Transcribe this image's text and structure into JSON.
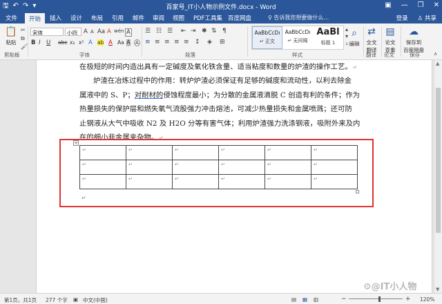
{
  "titlebar": {
    "title": "百家号_IT小人物示例文件.docx - Word",
    "qat": [
      "save-icon",
      "undo-icon",
      "redo-icon",
      "customize-icon"
    ],
    "qat_glyphs": [
      "🖫",
      "↶",
      "↷",
      "▾"
    ],
    "window_buttons": [
      "ribbon-display-icon",
      "minimize-icon",
      "restore-icon",
      "close-icon"
    ],
    "window_glyphs": [
      "▣",
      "—",
      "❐",
      "✕"
    ]
  },
  "tabs": [
    "文件",
    "开始",
    "插入",
    "设计",
    "布局",
    "引用",
    "邮件",
    "审阅",
    "视图",
    "PDF工具集",
    "百度网盘"
  ],
  "active_tab": "开始",
  "tell_me": "♀ 告诉我您想要做什么...",
  "account": {
    "login": "登录",
    "share": "♙ 共享"
  },
  "ribbon": {
    "clipboard": {
      "paste": "粘贴",
      "label": "剪贴板"
    },
    "font": {
      "font_name": "宋体",
      "font_size": "小四",
      "grow": "A",
      "shrink": "A",
      "aa": "Aa",
      "clear": "A",
      "wen": "wén",
      "char_border": "A",
      "row2": [
        "B",
        "I",
        "U",
        "abc",
        "x₂",
        "x²",
        "A",
        "ab",
        "A",
        "Aa",
        "A",
        "A",
        "⊕"
      ],
      "label": "字体"
    },
    "paragraph": {
      "label": "段落"
    },
    "styles": {
      "items": [
        {
          "sample": "AaBbCcDı",
          "name": "↵ 正文"
        },
        {
          "sample": "AaBbCcDı",
          "name": "↵ 无间隔"
        },
        {
          "sample": "AaBl",
          "name": "标题 1"
        }
      ],
      "label": "样式"
    },
    "editing": {
      "label": "编辑"
    },
    "fulltext": {
      "label": "全文\n翻译"
    },
    "check": {
      "label": "论文\n查重"
    },
    "save_baidu": {
      "label": "保存到\n百度网盘"
    },
    "group_labels": {
      "translate": "翻译",
      "paper": "论文",
      "save": "保存"
    }
  },
  "document": {
    "line1": "在极短的时间内造出具有一定碱度及氧化铁含量、适当粘度和数量的炉渣的操作工艺。",
    "para2_lines": [
      [
        "炉渣在冶炼过程中的作用：转炉炉渣必须保证有足够的碱度和流动性，以利去除金",
        "",
        ""
      ],
      [
        "属液中的 S、P；",
        "对耐材的",
        "侵蚀程度最小；为分散的金属液滴脱 C 创造有利的条件；作为"
      ],
      [
        "热量损失的保护层和燃失氧气流股强力冲击熔池，可减少热量损失和金属喷溅；还可防",
        "",
        ""
      ],
      [
        "止钢液从大气中吸收 N2 及 H2O 分等有害气体；利用炉渣强力洗涤钢液，吸附外来及内",
        "",
        ""
      ],
      [
        "在的细小非金属夹杂物。",
        "",
        ""
      ]
    ],
    "pilcrow": "↵",
    "cell_mark": "↵",
    "table": {
      "rows": 3,
      "cols": 6
    },
    "table_handle": "+"
  },
  "statusbar": {
    "page": "第1页，共1页",
    "words": "277 个字",
    "proof_icon": "proofing-icon",
    "language": "中文(中国)",
    "zoom": "120%",
    "zoom_minus": "−",
    "zoom_plus": "+"
  },
  "watermark": "⚙@IT小人物",
  "colors": {
    "accent": "#2b579a",
    "highlight_box": "#e03131"
  }
}
